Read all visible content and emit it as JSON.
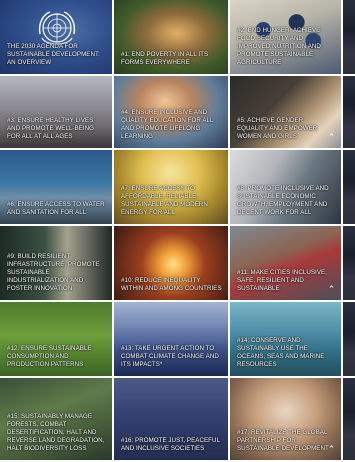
{
  "tiles": [
    {
      "caption": "THE 2030 AGENDA FOR SUSTAINABLE DEVELOPMENT: AN OVERVIEW"
    },
    {
      "caption": "#1: END POVERTY IN ALL ITS FORMS EVERYWHERE"
    },
    {
      "caption": "#2: END HUNGER, ACHIEVE FOOD SECURITY AND IMPROVED NUTRITION AND PROMOTE SUSTAINABLE AGRICULTURE"
    },
    {
      "caption": "#3: ENSURE HEALTHY LIVES AND PROMOTE WELL-BEING FOR ALL AT ALL AGES"
    },
    {
      "caption": "#4: ENSURE INCLUSIVE AND QUALITY EDUCATION FOR ALL AND PROMOTE LIFELONG LEARNING"
    },
    {
      "caption": "#5: ACHIEVE GENDER EQUALITY AND EMPOWER WOMEN AND GIRLS"
    },
    {
      "caption": "#6: ENSURE ACCESS TO WATER AND SANITATION FOR ALL"
    },
    {
      "caption": "#7: ENSURE ACCESS TO AFFORDABLE, RELIABLE, SUSTAINABLE AND MODERN ENERGY FOR ALL"
    },
    {
      "caption": "#8: PROMOTE INCLUSIVE AND SUSTAINABLE ECONOMIC GROWTH, EMPLOYMENT AND DECENT WORK FOR ALL"
    },
    {
      "caption": "#9: BUILD RESILIENT INFRASTRUCTURE, PROMOTE SUSTAINABLE INDUSTRIALIZATION AND FOSTER INNOVATION"
    },
    {
      "caption": "#10: REDUCE INEQUALITY WITHIN AND AMONG COUNTRIES"
    },
    {
      "caption": "#11: MAKE CITIES INCLUSIVE, SAFE, RESILIENT AND SUSTAINABLE"
    },
    {
      "caption": "#12: ENSURE SUSTAINABLE CONSUMPTION AND PRODUCTION PATTERNS"
    },
    {
      "caption": "#13: TAKE URGENT ACTION TO COMBAT CLIMATE CHANGE AND ITS IMPACTS*"
    },
    {
      "caption": "#14: CONSERVE AND SUSTAINABLY USE THE OCEANS, SEAS AND MARINE RESOURCES"
    },
    {
      "caption": "#15: SUSTAINABLY MANAGE FORESTS, COMBAT DESERTIFICATION, HALT AND REVERSE LAND DEGRADATION, HALT BIODIVERSITY LOSS"
    },
    {
      "caption": "#16: PROMOTE JUST, PEACEFUL AND INCLUSIVE SOCIETIES"
    },
    {
      "caption": "#17: REVITALIZE THE GLOBAL PARTNERSHIP FOR SUSTAINABLE DEVELOPMENT"
    }
  ],
  "icons": {
    "logo": "un-emblem-icon",
    "scroll_up": "chevron-up-icon",
    "scroll_up_glyph": "⌃"
  },
  "colors": {
    "caption_text": "#ffffff",
    "grid_lines": "#ffffff"
  }
}
